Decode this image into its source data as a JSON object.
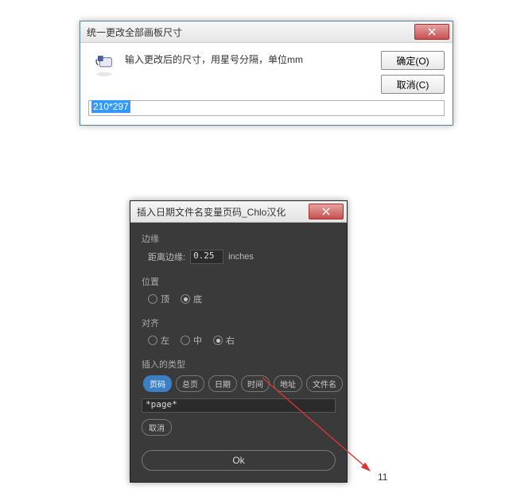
{
  "dialog1": {
    "title": "统一更改全部画板尺寸",
    "message": "输入更改后的尺寸，用星号分隔，单位mm",
    "ok_label": "确定(O)",
    "cancel_label": "取消(C)",
    "input_value": "210*297"
  },
  "dialog2": {
    "title": "插入日期文件名变量页码_Chlo汉化",
    "margin": {
      "label": "边缘",
      "field_label": "距离边缘:",
      "value": "0.25",
      "unit": "inches"
    },
    "position": {
      "label": "位置",
      "options": [
        "顶",
        "底"
      ],
      "selected": "底"
    },
    "align": {
      "label": "对齐",
      "options": [
        "左",
        "中",
        "右"
      ],
      "selected": "右"
    },
    "insert": {
      "label": "插入的类型",
      "options": [
        "页码",
        "总页",
        "日期",
        "时间",
        "地址",
        "文件名"
      ],
      "selected": "页码",
      "value": "*page*"
    },
    "cancel_label": "取消",
    "ok_label": "Ok"
  },
  "annotation": {
    "page_number": "11"
  }
}
